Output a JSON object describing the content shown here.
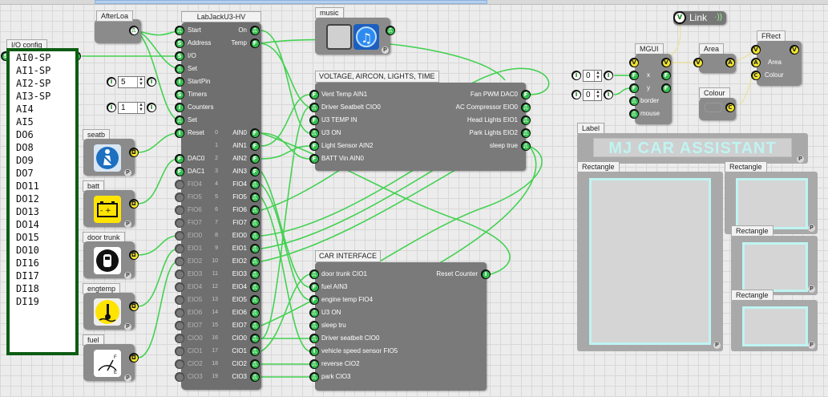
{
  "io_config": {
    "title": "I/O config",
    "items": [
      "AI0-SP",
      "AI1-SP",
      "AI2-SP",
      "AI3-SP",
      "AI4",
      "AI5",
      "DO6",
      "DO8",
      "DO9",
      "DO7",
      "DO11",
      "DO12",
      "DO13",
      "DO14",
      "DO15",
      "DO10",
      "DI16",
      "DI17",
      "DI18",
      "DI19"
    ]
  },
  "afterloa": {
    "title": "AfterLoa"
  },
  "labjack": {
    "title": "LabJackU3-HV",
    "inputs": [
      "Start",
      "Address",
      "I/O",
      "Set",
      "StartPin",
      "Timers",
      "Counters",
      "Set",
      "Reset",
      "",
      "DAC0",
      "DAC1"
    ],
    "status": [
      "On",
      "Temp"
    ],
    "startpin_value": "5",
    "counters_value": "1",
    "channels": [
      {
        "num": "0",
        "name": "AIN0"
      },
      {
        "num": "1",
        "name": "AIN1"
      },
      {
        "num": "2",
        "name": "AIN2"
      },
      {
        "num": "3",
        "name": "AIN3"
      },
      {
        "num": "4",
        "name": "FIO4"
      },
      {
        "num": "5",
        "name": "FIO5"
      },
      {
        "num": "6",
        "name": "FIO6"
      },
      {
        "num": "7",
        "name": "FIO7"
      },
      {
        "num": "8",
        "name": "EIO0"
      },
      {
        "num": "9",
        "name": "EIO1"
      },
      {
        "num": "10",
        "name": "EIO2"
      },
      {
        "num": "11",
        "name": "EIO3"
      },
      {
        "num": "12",
        "name": "EIO4"
      },
      {
        "num": "13",
        "name": "EIO5"
      },
      {
        "num": "14",
        "name": "EIO6"
      },
      {
        "num": "15",
        "name": "EIO7"
      },
      {
        "num": "16",
        "name": "CIO0"
      },
      {
        "num": "17",
        "name": "CIO1"
      },
      {
        "num": "18",
        "name": "CIO2"
      },
      {
        "num": "19",
        "name": "CIO3"
      }
    ],
    "left_dim": [
      "",
      "",
      "",
      "",
      "FIO4",
      "FIO5",
      "FIO6",
      "FIO7",
      "EIO0",
      "EIO1",
      "EIO2",
      "EIO3",
      "EIO4",
      "EIO5",
      "EIO6",
      "EIO7",
      "CIO0",
      "CIO1",
      "CIO2",
      "CIO3"
    ]
  },
  "side_blocks": [
    {
      "title": "seatb",
      "icon": "seatbelt-icon",
      "color": "#1d6fc0"
    },
    {
      "title": "batt",
      "icon": "battery-icon",
      "color": "#ffe400"
    },
    {
      "title": "door trunk",
      "icon": "car-door-icon",
      "color": "#ffffff"
    },
    {
      "title": "engtemp",
      "icon": "engine-temp-icon",
      "color": "#ffe400"
    },
    {
      "title": "fuel",
      "icon": "fuel-gauge-icon",
      "color": "#ffffff"
    }
  ],
  "fuel_gauge": {
    "full": "F",
    "empty": "E"
  },
  "music": {
    "title": "music"
  },
  "voltage": {
    "title": "VOLTAGE, AIRCON, LIGHTS, TIME",
    "left": [
      "Vent Temp AIN1",
      "Driver Seatbelt CIO0",
      "U3 TEMP IN",
      "U3 ON",
      "Light Sensor AIN2",
      "BATT Vin AIN0"
    ],
    "right": [
      "Fan PWM DAC0",
      "AC Compressor EIO0",
      "Head Lights EIO1",
      "Park Lights EIO2",
      "sleep true"
    ]
  },
  "car_interface": {
    "title": "CAR INTERFACE",
    "left": [
      "door trunk CIO1",
      "fuel AIN3",
      "engine temp FIO4",
      "U3 ON",
      "sleep tru",
      "Driver seatbelt CIO0",
      "vehicle speed sensor FIO5",
      "reverse CIO2",
      "park CIO3"
    ],
    "right": [
      "Reset Counter"
    ]
  },
  "link": {
    "label": "Link"
  },
  "mgui": {
    "title": "MGUI",
    "outputs": [
      "x",
      "y",
      "border",
      "mouse"
    ]
  },
  "area": {
    "title": "Area"
  },
  "frect": {
    "title": "FRect",
    "inputs": [
      "Area",
      "Colour"
    ]
  },
  "colour": {
    "title": "Colour"
  },
  "xinputs": [
    {
      "value": "0"
    },
    {
      "value": "0"
    }
  ],
  "label_block": {
    "title": "Label",
    "text": "MJ CAR ASSISTANT"
  },
  "rectangles": {
    "title": "Rectangle"
  }
}
